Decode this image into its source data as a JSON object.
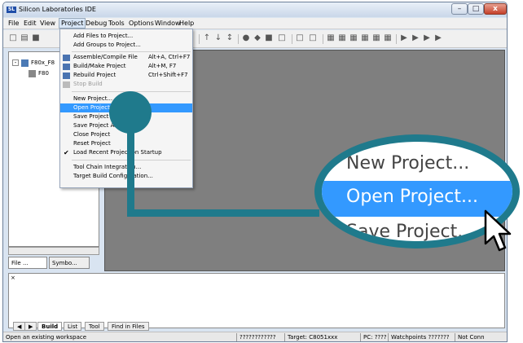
{
  "window": {
    "title": "Silicon Laboratories IDE",
    "controls": {
      "minimize": "–",
      "maximize": "□",
      "close": "x"
    }
  },
  "menubar": [
    "File",
    "Edit",
    "View",
    "Project",
    "Debug",
    "Tools",
    "Options",
    "Window",
    "Help"
  ],
  "project_menu": {
    "items": [
      {
        "label": "Add Files to Project...",
        "shortcut": "",
        "state": "normal"
      },
      {
        "label": "Add Groups to Project...",
        "shortcut": "",
        "state": "normal"
      },
      {
        "label": "Assemble/Compile File",
        "shortcut": "Alt+A, Ctrl+F7",
        "state": "normal",
        "icon": "compile-icon"
      },
      {
        "label": "Build/Make Project",
        "shortcut": "Alt+M, F7",
        "state": "normal",
        "icon": "build-icon"
      },
      {
        "label": "Rebuild Project",
        "shortcut": "Ctrl+Shift+F7",
        "state": "normal",
        "icon": "rebuild-icon"
      },
      {
        "label": "Stop Build",
        "shortcut": "",
        "state": "disabled",
        "icon": "stop-icon"
      },
      {
        "label": "New Project...",
        "shortcut": "",
        "state": "normal"
      },
      {
        "label": "Open Project...",
        "shortcut": "",
        "state": "highlight"
      },
      {
        "label": "Save Project",
        "shortcut": "",
        "state": "normal"
      },
      {
        "label": "Save Project As...",
        "shortcut": "",
        "state": "normal"
      },
      {
        "label": "Close Project",
        "shortcut": "",
        "state": "normal"
      },
      {
        "label": "Reset Project",
        "shortcut": "",
        "state": "normal"
      },
      {
        "label": "Load Recent Project on Startup",
        "shortcut": "",
        "state": "checked"
      },
      {
        "label": "Tool Chain Integration...",
        "shortcut": "",
        "state": "normal"
      },
      {
        "label": "Target Build Configuration...",
        "shortcut": "",
        "state": "normal"
      }
    ]
  },
  "tree": {
    "root": "F80x_F8",
    "child": "F80"
  },
  "left_tabs": [
    "File ...",
    "Symbo..."
  ],
  "output_tabs": [
    "Build",
    "List",
    "Tool",
    "Find in Files"
  ],
  "status": {
    "message": "Open an existing workspace",
    "cells": [
      "????????????",
      "Target: C8051xxx",
      "PC: ????",
      "Watchpoints ???????",
      "Not Conn"
    ]
  },
  "zoom": {
    "above": "New Project...",
    "focus": "Open Project...",
    "below": "Save Project..."
  },
  "colors": {
    "accent": "#1f7a8c",
    "highlight": "#3399ff"
  }
}
